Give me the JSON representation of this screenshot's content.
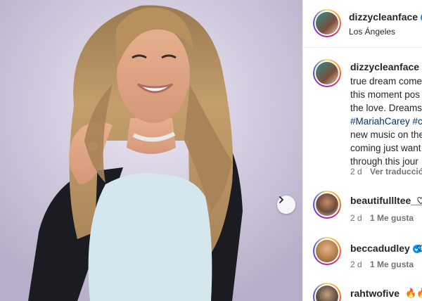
{
  "header": {
    "username": "dizzycleanface",
    "location": "Los Ángeles"
  },
  "caption": {
    "username": "dizzycleanface",
    "lines": [
      "true dream come",
      "this moment pos",
      "the love. Dreams",
      "#MariahCarey #c",
      "new music on the",
      "coming just want",
      "through this jour"
    ],
    "age": "2 d",
    "translate_label": "Ver traducción"
  },
  "comments": [
    {
      "username": "beautifullltee__",
      "age": "2 d",
      "likes": "1 Me gusta"
    },
    {
      "username": "beccadudley",
      "age": "2 d",
      "likes": "1 Me gusta"
    },
    {
      "username": "rahtwofive",
      "emoji": "🔥🔥"
    }
  ],
  "colors": {
    "verified_blue": "#0095f6",
    "hashtag": "#00376b",
    "muted": "#737373"
  },
  "icons": [
    "verified-badge-icon",
    "chevron-right-icon",
    "heart-icon"
  ]
}
